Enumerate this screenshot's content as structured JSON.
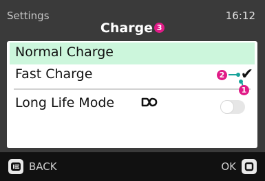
{
  "header": {
    "section": "Settings",
    "time": "16:12",
    "title": "Charge",
    "title_badge": "3"
  },
  "menu": {
    "items": [
      {
        "label": "Normal Charge",
        "selected": true
      },
      {
        "label": "Fast Charge",
        "checked": true,
        "callout_badge": "2"
      },
      {
        "label": "Long Life Mode",
        "toggle_on": false,
        "callout_badge": "1"
      }
    ]
  },
  "footer": {
    "back_label": "BACK",
    "ok_label": "OK"
  },
  "colors": {
    "background": "#3a3a3a",
    "panel": "#ffffff",
    "highlight": "#ccf6dc",
    "badge": "#e01b87",
    "callout": "#18a39b"
  },
  "icons": {
    "check": "check-icon",
    "long_life": "infinity-icon",
    "back": "back-key-icon",
    "ok": "ok-key-icon"
  }
}
